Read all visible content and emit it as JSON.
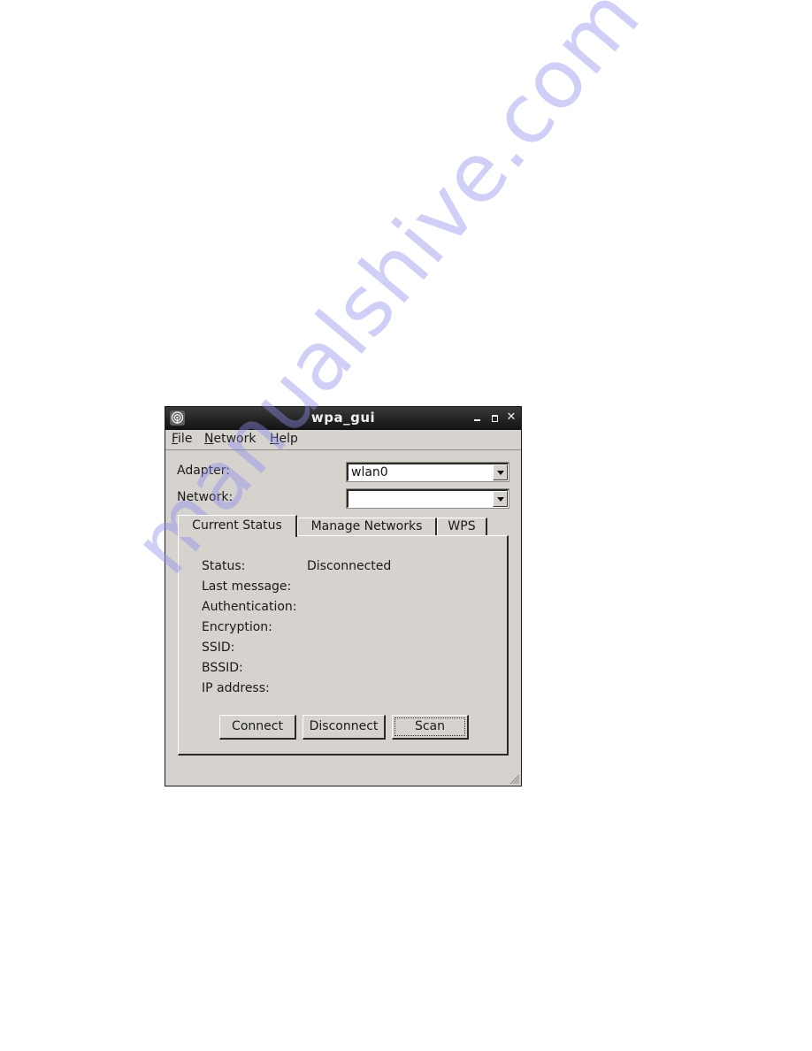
{
  "window": {
    "title": "wpa_gui",
    "icon": "wireless-signal-icon",
    "controls": {
      "minimize": "_",
      "maximize": "□",
      "close": "×"
    }
  },
  "menubar": {
    "items": [
      {
        "label": "File",
        "mnemonic": "F",
        "rest": "ile"
      },
      {
        "label": "Network",
        "mnemonic": "N",
        "rest": "etwork"
      },
      {
        "label": "Help",
        "mnemonic": "H",
        "rest": "elp"
      }
    ]
  },
  "adapter": {
    "label": "Adapter:",
    "value": "wlan0"
  },
  "network": {
    "label": "Network:",
    "value": ""
  },
  "tabs": [
    {
      "label": "Current Status",
      "active": true
    },
    {
      "label": "Manage Networks",
      "active": false
    },
    {
      "label": "WPS",
      "active": false
    }
  ],
  "status": {
    "rows": [
      {
        "label": "Status:",
        "value": "Disconnected"
      },
      {
        "label": "Last message:",
        "value": ""
      },
      {
        "label": "Authentication:",
        "value": ""
      },
      {
        "label": "Encryption:",
        "value": ""
      },
      {
        "label": "SSID:",
        "value": ""
      },
      {
        "label": "BSSID:",
        "value": ""
      },
      {
        "label": "IP address:",
        "value": ""
      }
    ]
  },
  "buttons": {
    "connect": "Connect",
    "disconnect": "Disconnect",
    "scan": "Scan"
  },
  "watermark": "manualshive.com"
}
